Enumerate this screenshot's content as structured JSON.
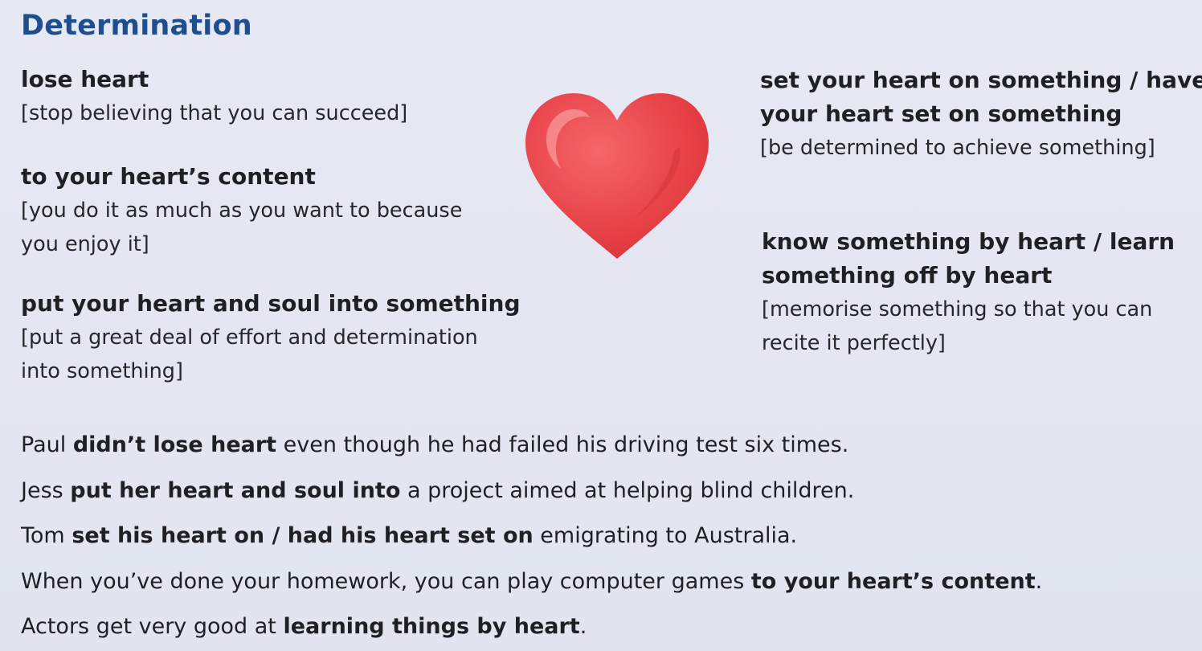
{
  "title": "Determination",
  "idioms": [
    {
      "phrase": "lose heart",
      "definition": "[stop believing that you can succeed]"
    },
    {
      "phrase": "to your heart’s content",
      "definition_line1": "[you do it as much as you want to because",
      "definition_line2": "you enjoy it]"
    },
    {
      "phrase": "put your heart and soul into something",
      "definition_line1": "[put a great deal of effort and determination",
      "definition_line2": "into something]"
    },
    {
      "phrase_line1": "set your heart on something / have",
      "phrase_line2": "your heart set on something",
      "definition": "[be determined to achieve something]"
    },
    {
      "phrase_line1": "know something by heart / learn",
      "phrase_line2": "something off by heart",
      "definition_line1": "[memorise something so that you can",
      "definition_line2": "recite it perfectly]"
    }
  ],
  "examples": [
    {
      "before": "Paul ",
      "bold": "didn’t lose heart",
      "after": " even though he had failed his driving test six times."
    },
    {
      "before": "Jess ",
      "bold": "put her heart and soul into",
      "after": " a project aimed at helping blind children."
    },
    {
      "before": "Tom ",
      "bold": "set his heart on / had his heart set on",
      "after": " emigrating to Australia."
    },
    {
      "before": "When you’ve done your homework, you can play computer games ",
      "bold": "to your heart’s content",
      "after": "."
    },
    {
      "before": "Actors get very good at ",
      "bold": "learning things by heart",
      "after": "."
    }
  ],
  "colors": {
    "title": "#1f4e8f",
    "heart": "#e8444a",
    "background": "#e3e6f1"
  },
  "icons": {
    "heart": "heart-icon"
  }
}
